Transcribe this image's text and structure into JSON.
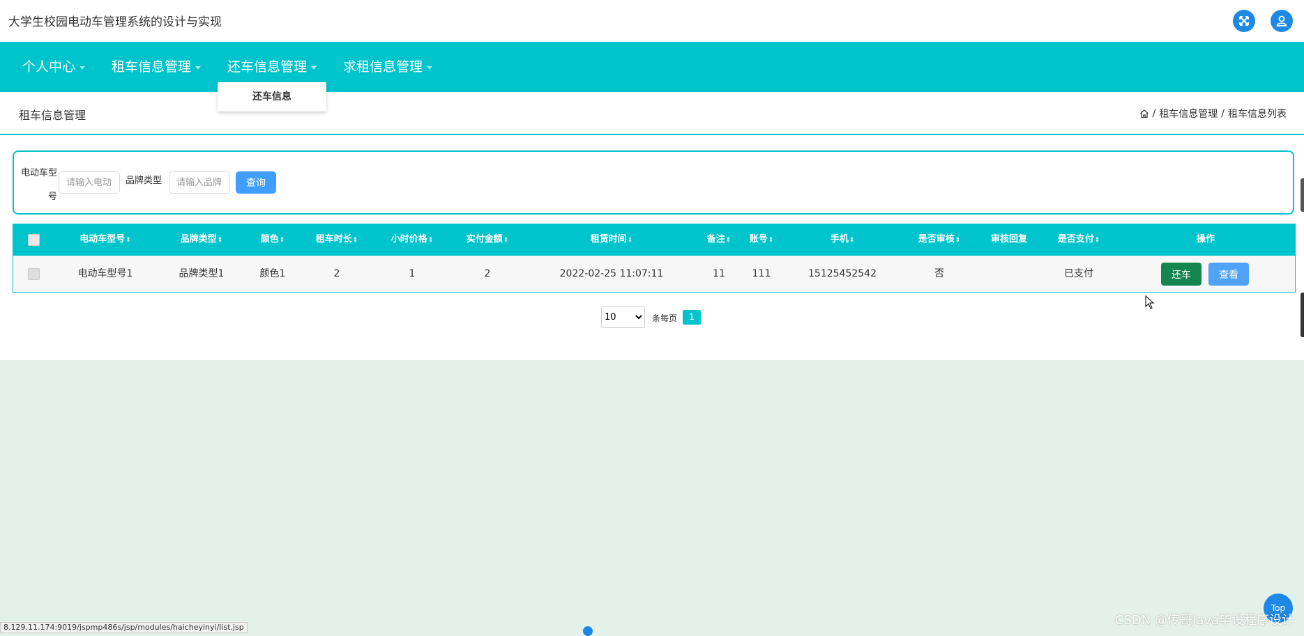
{
  "header": {
    "app_title": "大学生校园电动车管理系统的设计与实现",
    "fullscreen_icon": "expand-icon",
    "user_icon": "user-icon"
  },
  "nav": {
    "items": [
      {
        "label": "个人中心"
      },
      {
        "label": "租车信息管理"
      },
      {
        "label": "还车信息管理"
      },
      {
        "label": "求租信息管理"
      }
    ],
    "dropdown": {
      "items": [
        {
          "label": "还车信息"
        }
      ]
    }
  },
  "page": {
    "title": "租车信息管理",
    "breadcrumb": [
      "租车信息管理",
      "租车信息列表"
    ]
  },
  "search": {
    "label1_line1": "电动车型",
    "label1_line2": "号",
    "input1_placeholder": "请输入电动车型号",
    "label2": "品牌类型",
    "input2_placeholder": "请输入品牌类型",
    "button": "查询"
  },
  "table": {
    "columns": [
      {
        "label": "电动车型号",
        "sortable": true
      },
      {
        "label": "品牌类型",
        "sortable": true
      },
      {
        "label": "颜色",
        "sortable": true
      },
      {
        "label": "租车时长",
        "sortable": true
      },
      {
        "label": "小时价格",
        "sortable": true
      },
      {
        "label": "实付金额",
        "sortable": true
      },
      {
        "label": "租赁时间",
        "sortable": true
      },
      {
        "label": "备注",
        "sortable": true
      },
      {
        "label": "账号",
        "sortable": true
      },
      {
        "label": "手机",
        "sortable": true
      },
      {
        "label": "是否审核",
        "sortable": true
      },
      {
        "label": "审核回复",
        "sortable": false
      },
      {
        "label": "是否支付",
        "sortable": true
      },
      {
        "label": "操作",
        "sortable": false
      }
    ],
    "sort_glyph": "⇕",
    "rows": [
      [
        "电动车型号1",
        "品牌类型1",
        "颜色1",
        "2",
        "1",
        "2",
        "2022-02-25 11:07:11",
        "11",
        "111",
        "15125452542",
        "否",
        "",
        "已支付"
      ]
    ],
    "actions": {
      "return": "还车",
      "view": "查看"
    }
  },
  "pagination": {
    "page_size": "10",
    "per_page_label": "条每页",
    "current_page": "1"
  },
  "footer": {
    "status_url": "8.129.11.174:9019/jspmp486s/jsp/modules/haicheyinyi/list.jsp",
    "watermark": "CSDN @传哥Java毕设程序设计",
    "top_button": "Top"
  },
  "colors": {
    "accent": "#00c4cc",
    "primary": "#409eff",
    "success": "#14854e",
    "background": "#e4f0ea"
  }
}
